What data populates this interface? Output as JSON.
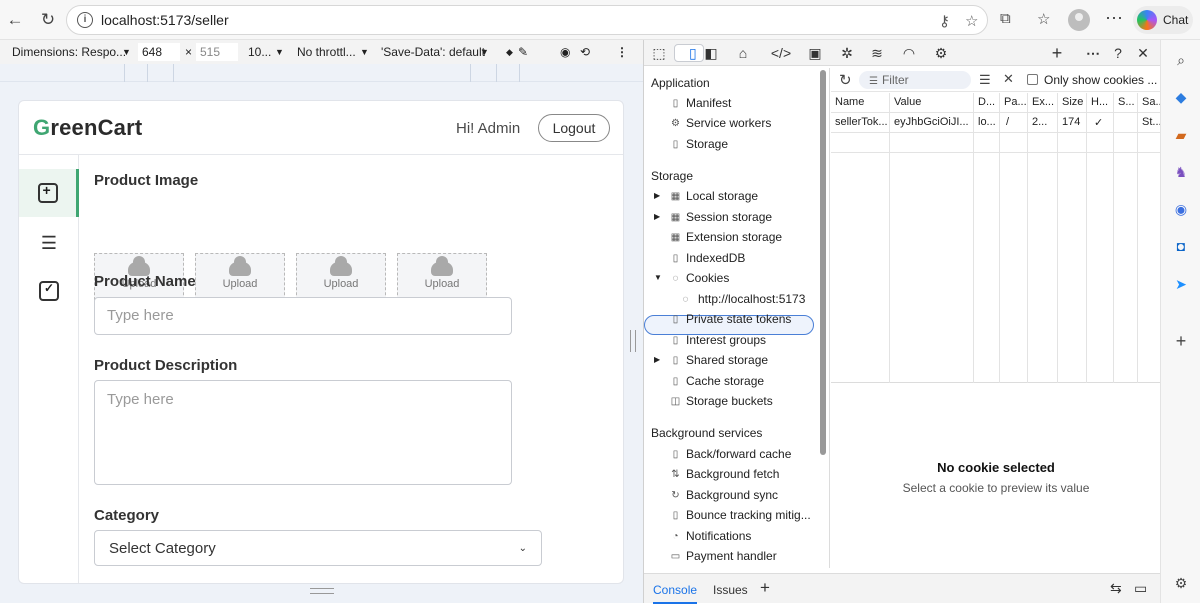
{
  "browser": {
    "url": "localhost:5173/seller",
    "chat_label": "Chat"
  },
  "device_toolbar": {
    "dimensions": "Dimensions: Respo...",
    "width": "648",
    "times": "×",
    "height": "515",
    "zoom": "10...",
    "throttle": "No throttl...",
    "save_data": "'Save-Data': default"
  },
  "app": {
    "logo_first": "G",
    "logo_rest": "reenCart",
    "greeting": "Hi! Admin",
    "logout_label": "Logout",
    "form": {
      "image_label": "Product Image",
      "upload_label": "Upload",
      "name_label": "Product Name",
      "name_placeholder": "Type here",
      "desc_label": "Product Description",
      "desc_placeholder": "Type here",
      "category_label": "Category",
      "category_selected": "Select Category"
    }
  },
  "devtools": {
    "sections": {
      "application": "Application",
      "storage": "Storage",
      "background": "Background services"
    },
    "application_items": [
      "Manifest",
      "Service workers",
      "Storage"
    ],
    "storage_items": [
      "Local storage",
      "Session storage",
      "Extension storage",
      "IndexedDB",
      "Cookies",
      "http://localhost:5173",
      "Private state tokens",
      "Interest groups",
      "Shared storage",
      "Cache storage",
      "Storage buckets"
    ],
    "background_items": [
      "Back/forward cache",
      "Background fetch",
      "Background sync",
      "Bounce tracking mitig...",
      "Notifications",
      "Payment handler"
    ],
    "filter_placeholder": "Filter",
    "only_show_label": "Only show cookies ...",
    "columns": [
      "Name",
      "Value",
      "D...",
      "Pa...",
      "Ex...",
      "Size",
      "H...",
      "S...",
      "Sa..."
    ],
    "row": [
      "sellerTok...",
      "eyJhbGciOiJI...",
      "lo...",
      "/",
      "2...",
      "174",
      "✓",
      "",
      "St..."
    ],
    "empty_title": "No cookie selected",
    "empty_sub": "Select a cookie to preview its value",
    "drawer_tabs": [
      "Console",
      "Issues"
    ]
  }
}
